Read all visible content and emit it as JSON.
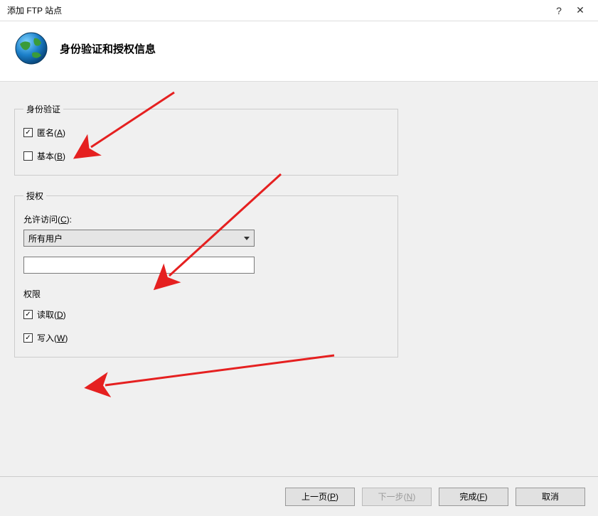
{
  "window": {
    "title": "添加 FTP 站点",
    "help": "?",
    "close": "✕"
  },
  "header": {
    "title": "身份验证和授权信息"
  },
  "auth": {
    "legend": "身份验证",
    "anonymous_label": "匿名(",
    "anonymous_key": "A",
    "anonymous_suffix": ")",
    "anonymous_checked": true,
    "basic_label": "基本(",
    "basic_key": "B",
    "basic_suffix": ")",
    "basic_checked": false
  },
  "authorization": {
    "legend": "授权",
    "access_label": "允许访问(",
    "access_key": "C",
    "access_suffix": "):",
    "access_value": "所有用户",
    "input_value": "",
    "permissions_label": "权限",
    "read_label": "读取(",
    "read_key": "D",
    "read_suffix": ")",
    "read_checked": true,
    "write_label": "写入(",
    "write_key": "W",
    "write_suffix": ")",
    "write_checked": true
  },
  "buttons": {
    "prev": "上一页(",
    "prev_key": "P",
    "prev_suffix": ")",
    "next": "下一步(",
    "next_key": "N",
    "next_suffix": ")",
    "finish": "完成(",
    "finish_key": "F",
    "finish_suffix": ")",
    "cancel": "取消"
  }
}
